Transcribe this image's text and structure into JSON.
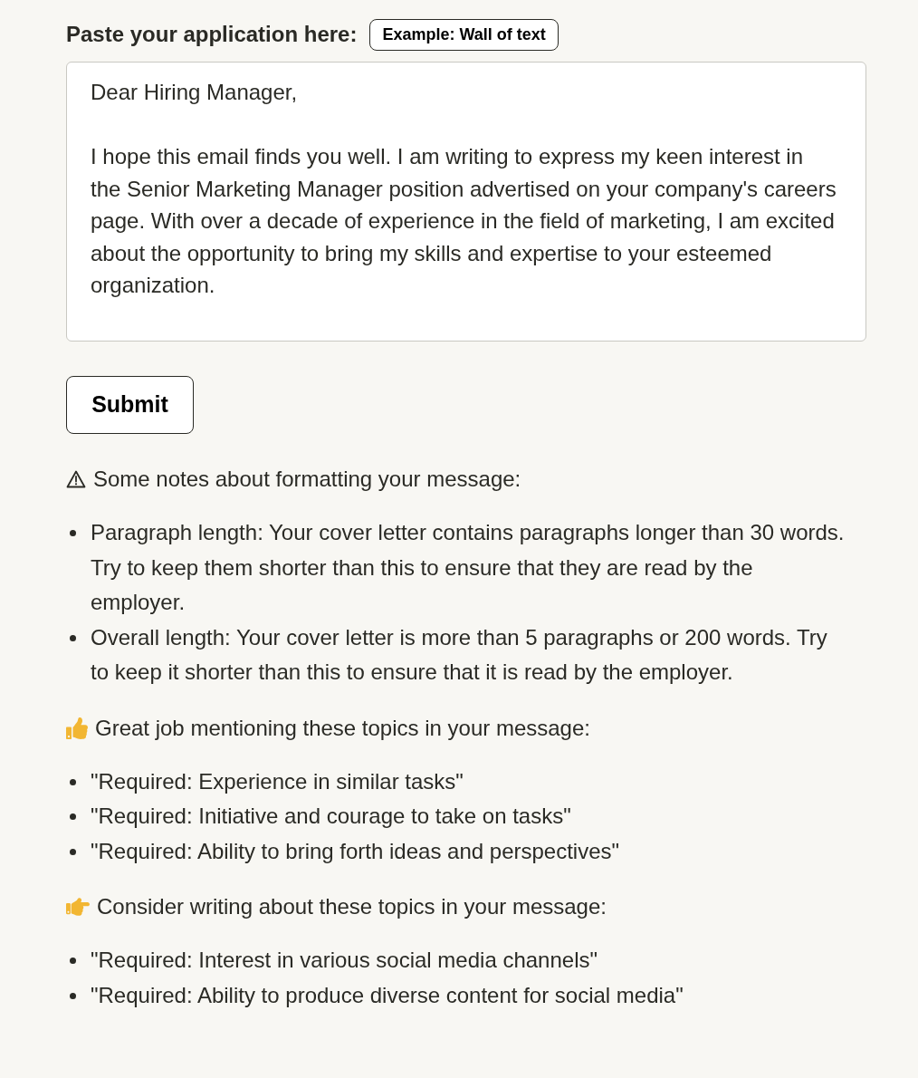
{
  "form": {
    "label": "Paste your application here:",
    "example_button": "Example: Wall of text",
    "application_text": "Dear Hiring Manager,\n\nI hope this email finds you well. I am writing to express my keen interest in the Senior Marketing Manager position advertised on your company's careers page. With over a decade of experience in the field of marketing, I am excited about the opportunity to bring my skills and expertise to your esteemed organization.",
    "submit_button": "Submit"
  },
  "sections": [
    {
      "kind": "warning",
      "heading": "Some notes about formatting your message:",
      "items": [
        "Paragraph length: Your cover letter contains paragraphs longer than 30 words. Try to keep them shorter than this to ensure that they are read by the employer.",
        "Overall length: Your cover letter is more than 5 paragraphs or 200 words. Try to keep it shorter than this to ensure that it is read by the employer."
      ]
    },
    {
      "kind": "praise",
      "heading": "Great job mentioning these topics in your message:",
      "items": [
        "\"Required: Experience in similar tasks\"",
        "\"Required: Initiative and courage to take on tasks\"",
        "\"Required: Ability to bring forth ideas and perspectives\""
      ]
    },
    {
      "kind": "suggestion",
      "heading": "Consider writing about these topics in your message:",
      "items": [
        "\"Required: Interest in various social media channels\"",
        "\"Required: Ability to produce diverse content for social media\""
      ]
    }
  ]
}
